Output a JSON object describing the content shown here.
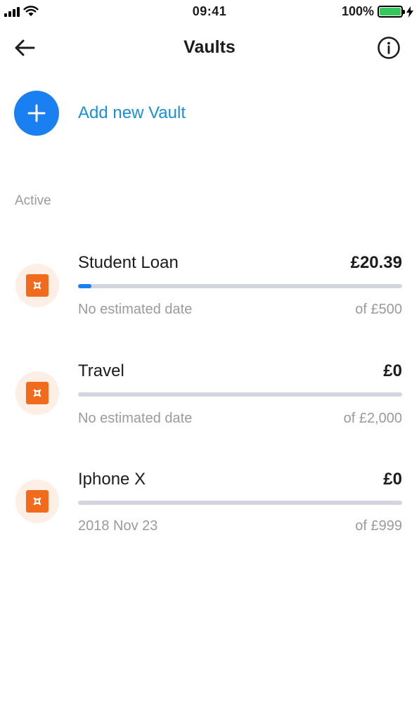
{
  "status_bar": {
    "time": "09:41",
    "battery_percent": "100%",
    "battery_color": "#34c759"
  },
  "nav": {
    "title": "Vaults",
    "back_icon": "arrow-left-icon",
    "info_icon": "info-circle-icon"
  },
  "add_vault": {
    "label": "Add new Vault",
    "icon": "plus-icon",
    "color": "#1a7ff0"
  },
  "section": {
    "label": "Active"
  },
  "vaults": [
    {
      "name": "Student Loan",
      "amount": "£20.39",
      "date": "No estimated date",
      "target": "of £500",
      "progress": 0.041
    },
    {
      "name": "Travel",
      "amount": "£0",
      "date": "No estimated date",
      "target": "of £2,000",
      "progress": 0
    },
    {
      "name": "Iphone X",
      "amount": "£0",
      "date": "2018 Nov 23",
      "target": "of £999",
      "progress": 0
    }
  ],
  "colors": {
    "accent": "#1a7ff0",
    "link": "#1a8fd9",
    "vault_icon": "#f26b1d",
    "vault_icon_bg": "#fdeee6",
    "muted_text": "#9a9aa0"
  }
}
